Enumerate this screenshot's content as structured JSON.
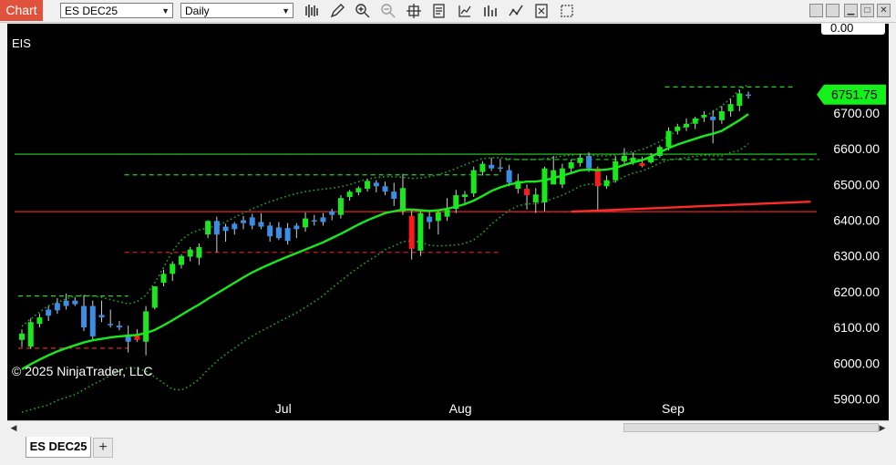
{
  "toolbar": {
    "chart_label": "Chart",
    "instrument": "ES DEC25",
    "interval": "Daily",
    "icons": [
      "bar-type-icon",
      "draw-pencil-icon",
      "zoom-in-icon",
      "zoom-out-icon",
      "crosshair-icon",
      "data-box-icon",
      "indicators-icon",
      "strategies-icon",
      "chart-style-icon",
      "properties-icon",
      "snapshot-icon"
    ]
  },
  "window_controls": [
    "restore-icon",
    "minimize-icon",
    "maximize-icon",
    "close-icon"
  ],
  "chart": {
    "instrument_label": "EIS",
    "copyright": "© 2025 NinjaTrader, LLC",
    "last_price_label": "6751.75",
    "top_label": "0.00",
    "colors": {
      "up": "#18e81c",
      "down": "#ff1a1a",
      "neutral": "#3a8ee6",
      "ma": "#18e81c",
      "band": "#1fa51f",
      "sr_green": "#27d127",
      "sr_red": "#e22222",
      "trend": "#ff2a2a",
      "price_tag": "#13f01a"
    }
  },
  "chart_data": {
    "type": "candlestick",
    "instrument": "ES DEC25",
    "interval": "Daily",
    "ylim": [
      5840,
      6950
    ],
    "yticks": [
      "5900.00",
      "6000.00",
      "6100.00",
      "6200.00",
      "6300.00",
      "6400.00",
      "6500.00",
      "6600.00",
      "6700.00"
    ],
    "xticks": [
      "Jul",
      "Aug",
      "Sep"
    ],
    "xtick_index": [
      29.5,
      49.5,
      73.5
    ],
    "levels": [
      {
        "price": 6585,
        "color": "green",
        "style": "solid"
      },
      {
        "price": 6424,
        "color": "red",
        "style": "solid"
      },
      {
        "price": 6527,
        "color": "green",
        "style": "dashed",
        "from": 12,
        "to": 54
      },
      {
        "price": 6310,
        "color": "red",
        "style": "dashed",
        "from": 12,
        "to": 54
      },
      {
        "price": 6570,
        "color": "green",
        "style": "dashed",
        "from": 55,
        "to": 90
      },
      {
        "price": 6424,
        "color": "red",
        "style": "dashed",
        "from": 55,
        "to": 70
      },
      {
        "price": 6188,
        "color": "green",
        "style": "dashed",
        "from": 0,
        "to": 12
      },
      {
        "price": 6042,
        "color": "red",
        "style": "dashed",
        "from": 0,
        "to": 12
      },
      {
        "price": 6773,
        "color": "green",
        "style": "dashed",
        "from": 73,
        "to": 87
      }
    ],
    "trendline": {
      "from": [
        62,
        6424
      ],
      "to": [
        88,
        6452
      ]
    },
    "candles": [
      {
        "o": 6065,
        "h": 6095,
        "l": 6045,
        "c": 6083,
        "t": "up"
      },
      {
        "o": 6046,
        "h": 6125,
        "l": 6040,
        "c": 6115,
        "t": "up"
      },
      {
        "o": 6110,
        "h": 6138,
        "l": 6100,
        "c": 6128,
        "t": "up"
      },
      {
        "o": 6133,
        "h": 6160,
        "l": 6118,
        "c": 6150,
        "t": "neutral"
      },
      {
        "o": 6148,
        "h": 6182,
        "l": 6138,
        "c": 6168,
        "t": "neutral"
      },
      {
        "o": 6160,
        "h": 6195,
        "l": 6150,
        "c": 6175,
        "t": "neutral"
      },
      {
        "o": 6175,
        "h": 6185,
        "l": 6160,
        "c": 6165,
        "t": "neutral"
      },
      {
        "o": 6160,
        "h": 6190,
        "l": 6090,
        "c": 6100,
        "t": "neutral"
      },
      {
        "o": 6075,
        "h": 6175,
        "l": 6062,
        "c": 6160,
        "t": "neutral"
      },
      {
        "o": 6135,
        "h": 6175,
        "l": 6115,
        "c": 6128,
        "t": "neutral"
      },
      {
        "o": 6110,
        "h": 6150,
        "l": 6100,
        "c": 6110,
        "t": "neutral"
      },
      {
        "o": 6105,
        "h": 6118,
        "l": 6092,
        "c": 6100,
        "t": "neutral"
      },
      {
        "o": 6080,
        "h": 6105,
        "l": 6030,
        "c": 6060,
        "t": "neutral"
      },
      {
        "o": 6080,
        "h": 6095,
        "l": 6060,
        "c": 6065,
        "t": "down"
      },
      {
        "o": 6060,
        "h": 6160,
        "l": 6022,
        "c": 6145,
        "t": "up"
      },
      {
        "o": 6155,
        "h": 6215,
        "l": 6150,
        "c": 6215,
        "t": "up"
      },
      {
        "o": 6225,
        "h": 6262,
        "l": 6215,
        "c": 6250,
        "t": "up"
      },
      {
        "o": 6250,
        "h": 6285,
        "l": 6230,
        "c": 6278,
        "t": "up"
      },
      {
        "o": 6275,
        "h": 6305,
        "l": 6265,
        "c": 6300,
        "t": "up"
      },
      {
        "o": 6298,
        "h": 6325,
        "l": 6285,
        "c": 6318,
        "t": "up"
      },
      {
        "o": 6295,
        "h": 6335,
        "l": 6275,
        "c": 6325,
        "t": "up"
      },
      {
        "o": 6360,
        "h": 6400,
        "l": 6350,
        "c": 6398,
        "t": "up"
      },
      {
        "o": 6398,
        "h": 6410,
        "l": 6310,
        "c": 6360,
        "t": "neutral"
      },
      {
        "o": 6370,
        "h": 6390,
        "l": 6340,
        "c": 6382,
        "t": "neutral"
      },
      {
        "o": 6375,
        "h": 6395,
        "l": 6360,
        "c": 6390,
        "t": "neutral"
      },
      {
        "o": 6392,
        "h": 6412,
        "l": 6375,
        "c": 6400,
        "t": "neutral"
      },
      {
        "o": 6408,
        "h": 6418,
        "l": 6375,
        "c": 6385,
        "t": "neutral"
      },
      {
        "o": 6395,
        "h": 6420,
        "l": 6375,
        "c": 6382,
        "t": "neutral"
      },
      {
        "o": 6385,
        "h": 6395,
        "l": 6340,
        "c": 6355,
        "t": "neutral"
      },
      {
        "o": 6380,
        "h": 6395,
        "l": 6345,
        "c": 6350,
        "t": "neutral"
      },
      {
        "o": 6378,
        "h": 6392,
        "l": 6332,
        "c": 6342,
        "t": "neutral"
      },
      {
        "o": 6375,
        "h": 6392,
        "l": 6350,
        "c": 6385,
        "t": "neutral"
      },
      {
        "o": 6380,
        "h": 6422,
        "l": 6368,
        "c": 6405,
        "t": "up"
      },
      {
        "o": 6400,
        "h": 6415,
        "l": 6385,
        "c": 6398,
        "t": "neutral"
      },
      {
        "o": 6395,
        "h": 6420,
        "l": 6385,
        "c": 6408,
        "t": "neutral"
      },
      {
        "o": 6415,
        "h": 6432,
        "l": 6400,
        "c": 6425,
        "t": "neutral"
      },
      {
        "o": 6415,
        "h": 6470,
        "l": 6405,
        "c": 6462,
        "t": "up"
      },
      {
        "o": 6465,
        "h": 6485,
        "l": 6455,
        "c": 6480,
        "t": "up"
      },
      {
        "o": 6478,
        "h": 6495,
        "l": 6470,
        "c": 6490,
        "t": "up"
      },
      {
        "o": 6488,
        "h": 6515,
        "l": 6480,
        "c": 6510,
        "t": "up"
      },
      {
        "o": 6505,
        "h": 6512,
        "l": 6478,
        "c": 6495,
        "t": "neutral"
      },
      {
        "o": 6495,
        "h": 6508,
        "l": 6470,
        "c": 6480,
        "t": "neutral"
      },
      {
        "o": 6480,
        "h": 6505,
        "l": 6440,
        "c": 6460,
        "t": "neutral"
      },
      {
        "o": 6425,
        "h": 6530,
        "l": 6415,
        "c": 6490,
        "t": "up"
      },
      {
        "o": 6412,
        "h": 6430,
        "l": 6290,
        "c": 6320,
        "t": "down"
      },
      {
        "o": 6315,
        "h": 6430,
        "l": 6300,
        "c": 6420,
        "t": "up"
      },
      {
        "o": 6410,
        "h": 6428,
        "l": 6375,
        "c": 6395,
        "t": "neutral"
      },
      {
        "o": 6398,
        "h": 6430,
        "l": 6360,
        "c": 6422,
        "t": "up"
      },
      {
        "o": 6410,
        "h": 6462,
        "l": 6398,
        "c": 6430,
        "t": "up"
      },
      {
        "o": 6432,
        "h": 6485,
        "l": 6420,
        "c": 6470,
        "t": "up"
      },
      {
        "o": 6465,
        "h": 6482,
        "l": 6448,
        "c": 6472,
        "t": "up"
      },
      {
        "o": 6475,
        "h": 6550,
        "l": 6465,
        "c": 6540,
        "t": "up"
      },
      {
        "o": 6535,
        "h": 6565,
        "l": 6525,
        "c": 6558,
        "t": "up"
      },
      {
        "o": 6555,
        "h": 6575,
        "l": 6538,
        "c": 6545,
        "t": "neutral"
      },
      {
        "o": 6548,
        "h": 6572,
        "l": 6535,
        "c": 6548,
        "t": "neutral"
      },
      {
        "o": 6540,
        "h": 6555,
        "l": 6495,
        "c": 6505,
        "t": "neutral"
      },
      {
        "o": 6510,
        "h": 6530,
        "l": 6475,
        "c": 6488,
        "t": "up"
      },
      {
        "o": 6488,
        "h": 6500,
        "l": 6430,
        "c": 6470,
        "t": "down"
      },
      {
        "o": 6472,
        "h": 6490,
        "l": 6420,
        "c": 6450,
        "t": "up"
      },
      {
        "o": 6450,
        "h": 6550,
        "l": 6425,
        "c": 6545,
        "t": "up"
      },
      {
        "o": 6540,
        "h": 6580,
        "l": 6530,
        "c": 6500,
        "t": "up"
      },
      {
        "o": 6500,
        "h": 6558,
        "l": 6490,
        "c": 6545,
        "t": "up"
      },
      {
        "o": 6545,
        "h": 6570,
        "l": 6530,
        "c": 6562,
        "t": "up"
      },
      {
        "o": 6560,
        "h": 6585,
        "l": 6550,
        "c": 6575,
        "t": "up"
      },
      {
        "o": 6580,
        "h": 6590,
        "l": 6535,
        "c": 6545,
        "t": "neutral"
      },
      {
        "o": 6545,
        "h": 6550,
        "l": 6430,
        "c": 6495,
        "t": "down"
      },
      {
        "o": 6495,
        "h": 6525,
        "l": 6488,
        "c": 6512,
        "t": "up"
      },
      {
        "o": 6512,
        "h": 6580,
        "l": 6505,
        "c": 6565,
        "t": "up"
      },
      {
        "o": 6565,
        "h": 6602,
        "l": 6555,
        "c": 6580,
        "t": "up"
      },
      {
        "o": 6575,
        "h": 6590,
        "l": 6555,
        "c": 6562,
        "t": "up"
      },
      {
        "o": 6560,
        "h": 6578,
        "l": 6548,
        "c": 6552,
        "t": "down"
      },
      {
        "o": 6562,
        "h": 6588,
        "l": 6558,
        "c": 6578,
        "t": "up"
      },
      {
        "o": 6580,
        "h": 6610,
        "l": 6575,
        "c": 6605,
        "t": "up"
      },
      {
        "o": 6605,
        "h": 6660,
        "l": 6595,
        "c": 6650,
        "t": "up"
      },
      {
        "o": 6650,
        "h": 6670,
        "l": 6640,
        "c": 6662,
        "t": "up"
      },
      {
        "o": 6660,
        "h": 6685,
        "l": 6650,
        "c": 6670,
        "t": "up"
      },
      {
        "o": 6670,
        "h": 6690,
        "l": 6655,
        "c": 6685,
        "t": "up"
      },
      {
        "o": 6688,
        "h": 6705,
        "l": 6675,
        "c": 6695,
        "t": "up"
      },
      {
        "o": 6690,
        "h": 6708,
        "l": 6615,
        "c": 6680,
        "t": "neutral"
      },
      {
        "o": 6680,
        "h": 6720,
        "l": 6670,
        "c": 6705,
        "t": "up"
      },
      {
        "o": 6705,
        "h": 6740,
        "l": 6690,
        "c": 6725,
        "t": "up"
      },
      {
        "o": 6720,
        "h": 6765,
        "l": 6705,
        "c": 6755,
        "t": "up"
      },
      {
        "o": 6752,
        "h": 6760,
        "l": 6740,
        "c": 6751.75,
        "t": "neutral"
      }
    ],
    "ma": [
      5983,
      5997,
      6010,
      6022,
      6033,
      6042,
      6050,
      6058,
      6064,
      6068,
      6072,
      6075,
      6077,
      6079,
      6084,
      6093,
      6106,
      6120,
      6135,
      6150,
      6164,
      6180,
      6195,
      6210,
      6225,
      6240,
      6254,
      6266,
      6277,
      6288,
      6298,
      6308,
      6318,
      6328,
      6338,
      6350,
      6362,
      6375,
      6388,
      6400,
      6410,
      6420,
      6425,
      6430,
      6430,
      6428,
      6426,
      6428,
      6432,
      6438,
      6445,
      6455,
      6468,
      6482,
      6492,
      6500,
      6505,
      6508,
      6508,
      6512,
      6518,
      6525,
      6532,
      6540,
      6542,
      6540,
      6542,
      6546,
      6555,
      6562,
      6568,
      6578,
      6590,
      6602,
      6612,
      6620,
      6628,
      6636,
      6642,
      6650,
      6665,
      6680,
      6697
    ],
    "upper_band": [
      6103,
      6124,
      6143,
      6161,
      6170,
      6180,
      6188,
      6190,
      6188,
      6184,
      6178,
      6172,
      6166,
      6172,
      6190,
      6225,
      6268,
      6313,
      6345,
      6363,
      6373,
      6378,
      6385,
      6395,
      6408,
      6420,
      6432,
      6442,
      6452,
      6460,
      6468,
      6475,
      6480,
      6484,
      6487,
      6490,
      6494,
      6500,
      6508,
      6515,
      6520,
      6522,
      6522,
      6520,
      6517,
      6518,
      6522,
      6528,
      6535,
      6545,
      6555,
      6565,
      6572,
      6575,
      6575,
      6572,
      6570,
      6570,
      6570,
      6572,
      6575,
      6580,
      6582,
      6585,
      6583,
      6580,
      6580,
      6583,
      6588,
      6592,
      6598,
      6608,
      6620,
      6635,
      6652,
      6665,
      6677,
      6690,
      6703,
      6720,
      6740,
      6765,
      6780
    ],
    "lower_band": [
      5863,
      5870,
      5877,
      5883,
      5896,
      5904,
      5912,
      5926,
      5940,
      5952,
      5966,
      5978,
      5988,
      5986,
      5978,
      5961,
      5944,
      5927,
      5925,
      5937,
      5955,
      5982,
      6005,
      6025,
      6042,
      6060,
      6076,
      6090,
      6102,
      6116,
      6128,
      6141,
      6156,
      6172,
      6189,
      6210,
      6230,
      6250,
      6268,
      6285,
      6300,
      6318,
      6328,
      6340,
      6343,
      6338,
      6330,
      6328,
      6329,
      6331,
      6335,
      6345,
      6364,
      6389,
      6409,
      6428,
      6440,
      6446,
      6446,
      6452,
      6461,
      6470,
      6482,
      6495,
      6501,
      6500,
      6504,
      6509,
      6522,
      6532,
      6538,
      6548,
      6560,
      6569,
      6572,
      6575,
      6579,
      6582,
      6581,
      6580,
      6590,
      6595,
      6614
    ]
  }
}
